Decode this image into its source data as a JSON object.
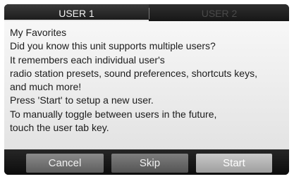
{
  "tabs": [
    {
      "label": "USER 1",
      "selected": true
    },
    {
      "label": "USER 2",
      "selected": false
    }
  ],
  "message": {
    "lines": [
      "My Favorites",
      "Did you know this unit supports multiple users?",
      "It remembers each individual user's",
      "radio station presets, sound preferences, shortcuts keys,",
      "and much more!",
      "Press 'Start' to setup a new user.",
      "To manually toggle between users in the future,",
      "touch the user tab key."
    ]
  },
  "buttons": {
    "cancel_label": "Cancel",
    "skip_label": "Skip",
    "start_label": "Start"
  },
  "colors": {
    "frame_background": "#1b1b1b",
    "panel_background": "#f2f2f2",
    "active_tab_text": "#f2f2f2",
    "inactive_tab_text": "#4a4a4a",
    "highlighted_button": "#b8b8b8"
  }
}
